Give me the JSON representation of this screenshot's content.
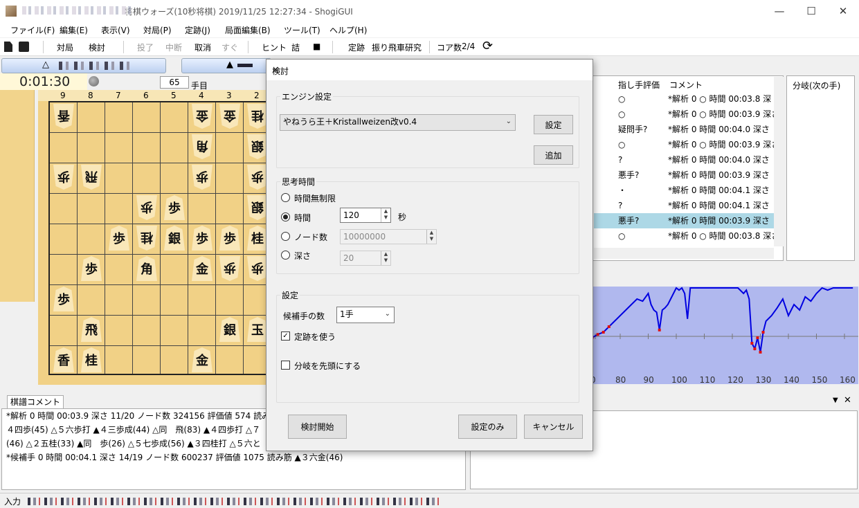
{
  "window": {
    "title": "将棋ウォーズ(10秒将棋) 2019/11/25 12:27:34 - ShogiGUI",
    "minimize": "—",
    "maximize": "☐",
    "close": "✕"
  },
  "menu": [
    "ファイル(F)",
    "編集(E)",
    "表示(V)",
    "対局(P)",
    "定跡(J)",
    "局面編集(B)",
    "ツール(T)",
    "ヘルプ(H)"
  ],
  "toolbar": {
    "taikyoku": "対局",
    "kento": "検討",
    "resign": "投了",
    "interrupt": "中断",
    "undo": "取消",
    "now": "すぐ",
    "hint": "ヒント",
    "tsume": "詰",
    "stop": "■",
    "joseki": "定跡",
    "furibisha": "振り飛車研究",
    "cores": "コア数",
    "cores_val": "2/4",
    "refresh_icon": "⟳"
  },
  "board": {
    "clock": "0:01:30",
    "move_number": "65",
    "move_unit": "手目",
    "files": [
      "9",
      "8",
      "7",
      "6",
      "5",
      "4",
      "3",
      "2"
    ],
    "player_marks": {
      "gote": "△",
      "sente": "▲"
    },
    "pieces": [
      {
        "c": "9",
        "r": "1",
        "t": "香",
        "g": true
      },
      {
        "c": "4",
        "r": "1",
        "t": "金",
        "g": true
      },
      {
        "c": "3",
        "r": "1",
        "t": "金",
        "g": true
      },
      {
        "c": "2",
        "r": "1",
        "t": "桂",
        "g": true
      },
      {
        "c": "4",
        "r": "2",
        "t": "角",
        "g": true
      },
      {
        "c": "2",
        "r": "2",
        "t": "銀",
        "g": true
      },
      {
        "c": "9",
        "r": "3",
        "t": "歩",
        "g": true
      },
      {
        "c": "8",
        "r": "3",
        "t": "飛",
        "g": true
      },
      {
        "c": "4",
        "r": "3",
        "t": "歩",
        "g": true
      },
      {
        "c": "2",
        "r": "3",
        "t": "歩",
        "g": true
      },
      {
        "c": "6",
        "r": "4",
        "t": "歩",
        "g": true
      },
      {
        "c": "5",
        "r": "4",
        "t": "歩",
        "g": false
      },
      {
        "c": "2",
        "r": "4",
        "t": "銀",
        "g": true
      },
      {
        "c": "7",
        "r": "5",
        "t": "歩",
        "g": false
      },
      {
        "c": "6",
        "r": "5",
        "t": "桂",
        "g": true
      },
      {
        "c": "5",
        "r": "5",
        "t": "銀",
        "g": false
      },
      {
        "c": "4",
        "r": "5",
        "t": "歩",
        "g": false
      },
      {
        "c": "3",
        "r": "5",
        "t": "歩",
        "g": false
      },
      {
        "c": "2",
        "r": "5",
        "t": "桂",
        "g": false
      },
      {
        "c": "8",
        "r": "6",
        "t": "歩",
        "g": false
      },
      {
        "c": "6",
        "r": "6",
        "t": "角",
        "g": false
      },
      {
        "c": "4",
        "r": "6",
        "t": "金",
        "g": false
      },
      {
        "c": "3",
        "r": "6",
        "t": "歩",
        "g": true
      },
      {
        "c": "2",
        "r": "6",
        "t": "歩",
        "g": true
      },
      {
        "c": "9",
        "r": "7",
        "t": "歩",
        "g": false
      },
      {
        "c": "8",
        "r": "8",
        "t": "飛",
        "g": false
      },
      {
        "c": "3",
        "r": "8",
        "t": "銀",
        "g": false
      },
      {
        "c": "2",
        "r": "8",
        "t": "玉",
        "g": false
      },
      {
        "c": "9",
        "r": "9",
        "t": "香",
        "g": false
      },
      {
        "c": "8",
        "r": "9",
        "t": "桂",
        "g": false
      },
      {
        "c": "4",
        "r": "9",
        "t": "金",
        "g": false
      }
    ]
  },
  "comment": {
    "tab": "棋譜コメント",
    "lines": [
      "*解析 0  時間 00:03.9 深さ 11/20 ノード数 324156 評価値 574 読み",
      "４四歩(45) △５六歩打 ▲４三歩成(44) △同　飛(83) ▲４四歩打 △７",
      "(46) △２五桂(33) ▲同　歩(26) △５七歩成(56) ▲３四桂打 △５六と",
      "*候補手 0  時間 00:04.1 深さ 14/19 ノード数 600237 評価値 1075 読み筋 ▲３六金(46)"
    ]
  },
  "status": {
    "input": "入力"
  },
  "kifu": {
    "headers": {
      "eval": "指し手評価",
      "comment": "コメント"
    },
    "rows": [
      {
        "eval": "○",
        "comment": "*解析 0 ○ 時間 00:03.8 深"
      },
      {
        "eval": "○",
        "comment": "*解析 0 ○ 時間 00:03.9 深さ"
      },
      {
        "eval": "疑問手?",
        "comment": "*解析 0  時間 00:04.0 深さ"
      },
      {
        "eval": "○",
        "comment": "*解析 0 ○ 時間 00:03.9 深さ"
      },
      {
        "eval": "?",
        "comment": "*解析 0  時間 00:04.0 深さ"
      },
      {
        "eval": "悪手?",
        "comment": "*解析 0  時間 00:03.9 深さ"
      },
      {
        "eval": "・",
        "comment": "*解析 0  時間 00:04.1 深さ"
      },
      {
        "eval": "?",
        "comment": "*解析 0  時間 00:04.1 深さ"
      },
      {
        "eval": "悪手?",
        "comment": "*解析 0  時間 00:03.9 深さ",
        "selected": true
      },
      {
        "eval": "○",
        "comment": "*解析 0 ○ 時間 00:03.8 深さ"
      }
    ]
  },
  "branch": {
    "header": "分岐(次の手)"
  },
  "graph": {
    "x_ticks": [
      "0",
      "80",
      "90",
      "100",
      "110",
      "120",
      "130",
      "140",
      "150",
      "160"
    ],
    "line_color": "#0000e0",
    "bg_color": "#b0b8ee",
    "series": [
      [
        70,
        0.45
      ],
      [
        72,
        0.42
      ],
      [
        74,
        0.4
      ],
      [
        76,
        0.35
      ],
      [
        78,
        0.3
      ],
      [
        80,
        0.25
      ],
      [
        82,
        0.2
      ],
      [
        84,
        0.15
      ],
      [
        86,
        0.1
      ],
      [
        88,
        0.12
      ],
      [
        90,
        0.05
      ],
      [
        91,
        0.15
      ],
      [
        92,
        0.2
      ],
      [
        93,
        0.22
      ],
      [
        94,
        0.38
      ],
      [
        95,
        0.2
      ],
      [
        96,
        0.18
      ],
      [
        97,
        0.15
      ],
      [
        98,
        0.1
      ],
      [
        99,
        0.05
      ],
      [
        100,
        0.0
      ],
      [
        101,
        0.02
      ],
      [
        102,
        0.0
      ],
      [
        103,
        0.05
      ],
      [
        104,
        0.28
      ],
      [
        105,
        0.0
      ],
      [
        110,
        0.0
      ],
      [
        115,
        0.0
      ],
      [
        120,
        0.0
      ],
      [
        122,
        0.0
      ],
      [
        124,
        0.05
      ],
      [
        125,
        0.02
      ],
      [
        126,
        0.1
      ],
      [
        127,
        0.5
      ],
      [
        128,
        0.55
      ],
      [
        129,
        0.45
      ],
      [
        130,
        0.58
      ],
      [
        131,
        0.4
      ],
      [
        132,
        0.3
      ],
      [
        134,
        0.25
      ],
      [
        136,
        0.18
      ],
      [
        138,
        0.1
      ],
      [
        140,
        0.25
      ],
      [
        142,
        0.15
      ],
      [
        144,
        0.2
      ],
      [
        146,
        0.08
      ],
      [
        148,
        0.12
      ],
      [
        150,
        0.05
      ],
      [
        152,
        0.0
      ],
      [
        154,
        0.02
      ],
      [
        156,
        0.0
      ],
      [
        160,
        0.0
      ],
      [
        163,
        0.0
      ]
    ]
  },
  "dialog": {
    "title": "検討",
    "close": "✕",
    "engine_group": "エンジン設定",
    "engine_name": "やねうら王＋Kristallweizen改v0.4",
    "settings_btn": "設定",
    "add_btn": "追加",
    "time_group": "思考時間",
    "radio_unlimited": "時間無制限",
    "radio_time": "時間",
    "time_value": "120",
    "time_unit": "秒",
    "radio_nodes": "ノード数",
    "nodes_value": "10000000",
    "radio_depth": "深さ",
    "depth_value": "20",
    "settings_group": "設定",
    "candidates_label": "候補手の数",
    "candidates_value": "1手",
    "use_joseki": "定跡を使う",
    "branch_first": "分岐を先頭にする",
    "start_btn": "検討開始",
    "save_btn": "設定のみ",
    "cancel_btn": "キャンセル"
  }
}
